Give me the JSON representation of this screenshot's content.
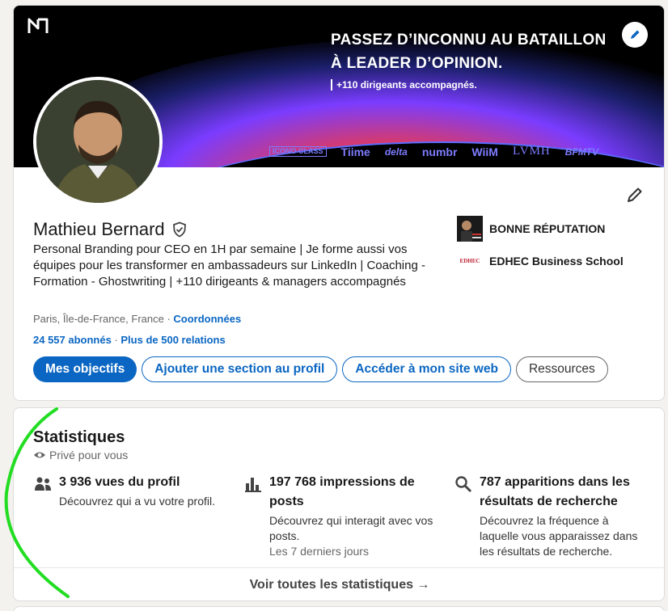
{
  "banner": {
    "title_line1": "PASSEZ D’INCONNU AU BATAILLON",
    "title_line2": "À LEADER D’OPINION.",
    "subtitle": "+110 dirigeants accompagnés.",
    "brands": [
      "ICONO CLASS",
      "Tiime",
      "delta",
      "numbr",
      "WiiM",
      "LVMH",
      "BFMTV"
    ],
    "edit_icon": "pencil-icon"
  },
  "profile": {
    "name": "Mathieu Bernard",
    "verified_icon": "verified-shield-icon",
    "headline": "Personal Branding pour CEO en 1H par semaine | Je forme aussi vos équipes pour les transformer en ambassadeurs sur LinkedIn | Coaching - Formation - Ghostwriting | +110 dirigeants & managers accompagnés",
    "location": "Paris, Île-de-France, France",
    "location_sep": " · ",
    "contact_link": "Coordonnées",
    "followers": "24 557 abonnés",
    "counts_sep": " · ",
    "connections": "Plus de 500 relations",
    "experience": [
      {
        "label": "BONNE RÉPUTATION",
        "thumb": "BONNE RÉPUTATION"
      },
      {
        "label": "EDHEC Business School",
        "thumb": "EDHEC"
      }
    ]
  },
  "actions": {
    "objectives": "Mes objectifs",
    "add_section": "Ajouter une section au profil",
    "website": "Accéder à mon site web",
    "resources": "Ressources"
  },
  "stats": {
    "title": "Statistiques",
    "private_label": "Privé pour vous",
    "items": [
      {
        "title": "3 936 vues du profil",
        "desc": "Découvrez qui a vu votre profil.",
        "meta": "",
        "icon": "people-icon"
      },
      {
        "title": "197 768 impressions de posts",
        "desc": "Découvrez qui interagit avec vos posts.",
        "meta": "Les 7 derniers jours",
        "icon": "bar-chart-icon"
      },
      {
        "title": "787 apparitions dans les résultats de recherche",
        "desc": "Découvrez la fréquence à laquelle vous apparaissez dans les résultats de recherche.",
        "meta": "",
        "icon": "search-icon"
      }
    ],
    "footer_link": "Voir toutes les statistiques →"
  },
  "colors": {
    "link_blue": "#0a66c2",
    "annotation_green": "#22dd22",
    "banner_purple": "#7d7cff"
  }
}
